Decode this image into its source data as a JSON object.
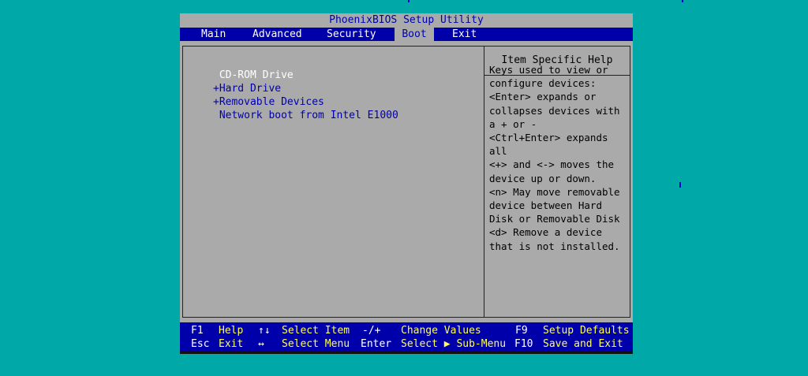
{
  "title": "PhoenixBIOS Setup Utility",
  "menu": {
    "main": "Main",
    "advanced": "Advanced",
    "security": "Security",
    "boot": "Boot",
    "exit": "Exit"
  },
  "boot_items": [
    " CD-ROM Drive",
    "+Hard Drive",
    "+Removable Devices",
    " Network boot from Intel E1000"
  ],
  "help": {
    "title": "Item Specific Help",
    "text": "Keys used to view or\nconfigure devices:\n<Enter> expands or\ncollapses devices with\na + or -\n<Ctrl+Enter> expands\nall\n<+> and <-> moves the\ndevice up or down.\n<n> May move removable\ndevice between Hard\nDisk or Removable Disk\n<d> Remove a device\nthat is not installed."
  },
  "status": {
    "f1_key": "F1",
    "f1_desc": "Help",
    "updown_key": "↑↓",
    "updown_desc": "Select Item",
    "plusminus_key": "-/+",
    "plusminus_desc": "Change Values",
    "f9_key": "F9",
    "f9_desc": "Setup Defaults",
    "esc_key": "Esc",
    "esc_desc": "Exit",
    "leftright_key": "↔",
    "leftright_desc": "Select Menu",
    "enter_key": "Enter",
    "enter_desc": "Select ▶ Sub-Menu",
    "f10_key": "F10",
    "f10_desc": "Save and Exit"
  },
  "colors": {
    "desktop": "#00a8a8",
    "panel_gray": "#aaaaaa",
    "bios_blue": "#0000aa",
    "highlight_white": "#ffffff",
    "status_yellow": "#ffff55"
  }
}
